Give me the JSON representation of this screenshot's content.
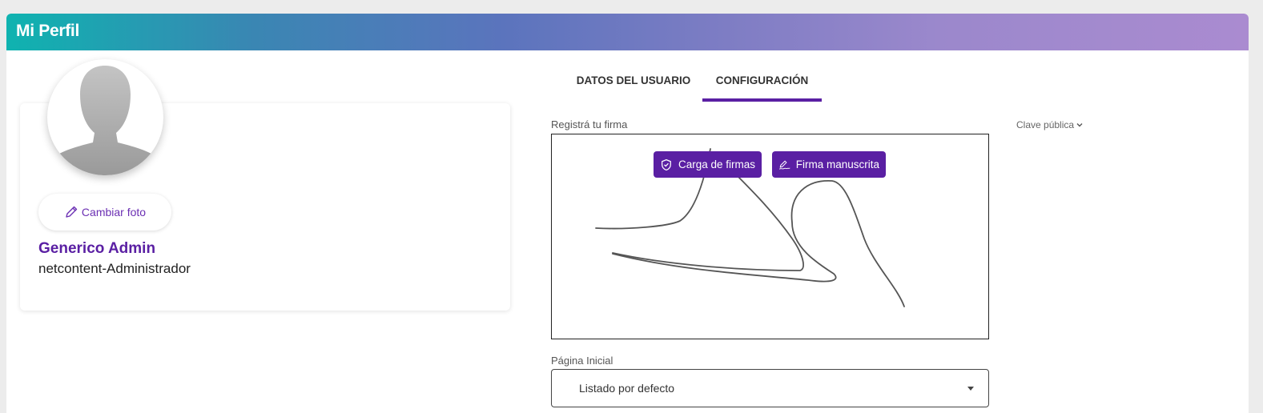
{
  "header": {
    "title": "Mi Perfil"
  },
  "profile": {
    "change_photo_label": "Cambiar foto",
    "name": "Generico Admin",
    "role": "netcontent-Administrador"
  },
  "tabs": [
    {
      "label": "DATOS DEL USUARIO",
      "active": false
    },
    {
      "label": "CONFIGURACIÓN",
      "active": true
    }
  ],
  "signature": {
    "label": "Registrá tu firma",
    "upload_button": "Carga de firmas",
    "handwritten_button": "Firma manuscrita"
  },
  "public_key": {
    "label": "Clave pública"
  },
  "home_page": {
    "label": "Página Inicial",
    "selected": "Listado por defecto"
  },
  "colors": {
    "accent": "#5a1fa3",
    "header_gradient_start": "#0fb3b0",
    "header_gradient_end": "#aa8bd0"
  },
  "icons": {
    "pencil": "pencil-icon",
    "shield": "shield-check-icon",
    "signature": "signature-pen-icon",
    "chevron": "chevron-down-icon",
    "caret": "caret-down-icon",
    "avatar": "avatar-placeholder-icon"
  }
}
